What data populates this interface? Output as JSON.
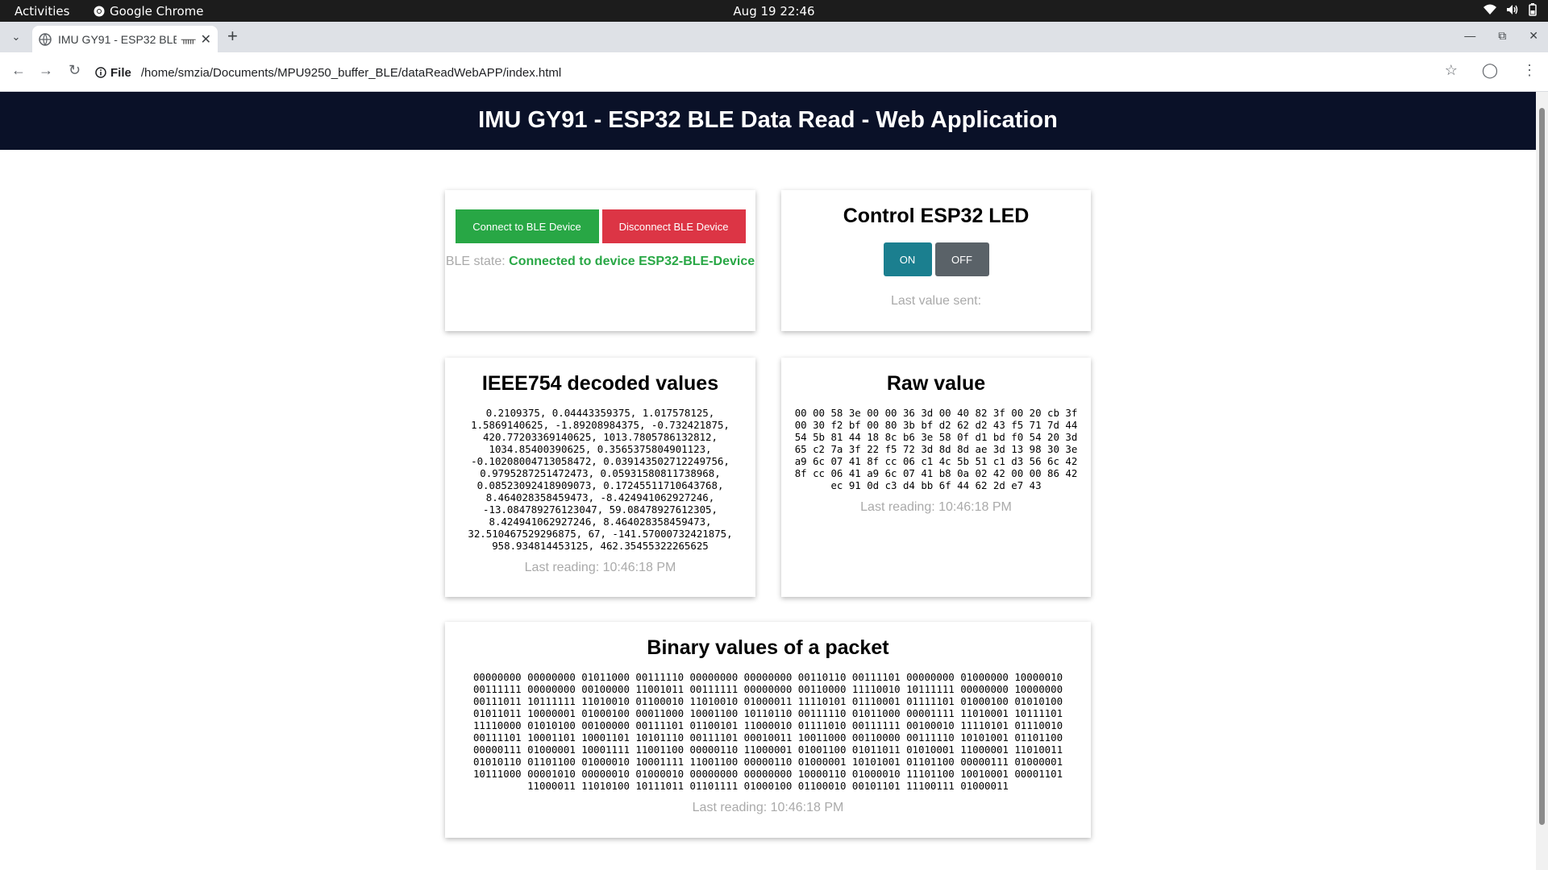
{
  "system": {
    "activities": "Activities",
    "app_name": "Google Chrome",
    "clock": "Aug 19  22:46"
  },
  "browser": {
    "tab_title": "IMU GY91 - ESP32 BLE Data Read - Web Application",
    "url_scheme": "File",
    "url": "/home/smzia/Documents/MPU9250_buffer_BLE/dataReadWebAPP/index.html"
  },
  "page": {
    "header": "IMU GY91 - ESP32 BLE Data Read - Web Application",
    "connection": {
      "connect_label": "Connect to BLE Device",
      "disconnect_label": "Disconnect BLE Device",
      "state_label": "BLE state:",
      "state_value": "Connected to device ESP32-BLE-Device",
      "state_color": "#28a745"
    },
    "led": {
      "title": "Control ESP32 LED",
      "on_label": "ON",
      "off_label": "OFF",
      "last_sent_label": "Last value sent:"
    },
    "decoded": {
      "title": "IEEE754 decoded values",
      "values": "0.2109375, 0.04443359375, 1.017578125,\n1.5869140625, -1.89208984375, -0.732421875,\n420.77203369140625, 1013.7805786132812,\n1034.85400390625, 0.3565375804901123,\n-0.10208004713058472, 0.039143502712249756,\n0.9795287251472473, 0.05931580811738968,\n0.08523092418909073, 0.17245511710643768,\n8.464028358459473, -8.424941062927246,\n-13.084789276123047, 59.08478927612305,\n8.424941062927246, 8.464028358459473,\n32.510467529296875, 67, -141.57000732421875,\n958.934814453125, 462.35455322265625",
      "last_reading": "Last reading: 10:46:18 PM"
    },
    "raw": {
      "title": "Raw value",
      "values": "00 00 58 3e 00 00 36 3d 00 40 82 3f 00 20 cb 3f\n00 30 f2 bf 00 80 3b bf d2 62 d2 43 f5 71 7d 44\n54 5b 81 44 18 8c b6 3e 58 0f d1 bd f0 54 20 3d\n65 c2 7a 3f 22 f5 72 3d 8d 8d ae 3d 13 98 30 3e\na9 6c 07 41 8f cc 06 c1 4c 5b 51 c1 d3 56 6c 42\n8f cc 06 41 a9 6c 07 41 b8 0a 02 42 00 00 86 42\nec 91 0d c3 d4 bb 6f 44 62 2d e7 43",
      "last_reading": "Last reading: 10:46:18 PM"
    },
    "binary": {
      "title": "Binary values of a packet",
      "values": "00000000 00000000 01011000 00111110 00000000 00000000 00110110 00111101 00000000 01000000 10000010\n00111111 00000000 00100000 11001011 00111111 00000000 00110000 11110010 10111111 00000000 10000000\n00111011 10111111 11010010 01100010 11010010 01000011 11110101 01110001 01111101 01000100 01010100\n01011011 10000001 01000100 00011000 10001100 10110110 00111110 01011000 00001111 11010001 10111101\n11110000 01010100 00100000 00111101 01100101 11000010 01111010 00111111 00100010 11110101 01110010\n00111101 10001101 10001101 10101110 00111101 00010011 10011000 00110000 00111110 10101001 01101100\n00000111 01000001 10001111 11001100 00000110 11000001 01001100 01011011 01010001 11000001 11010011\n01010110 01101100 01000010 10001111 11001100 00000110 01000001 10101001 01101100 00000111 01000001\n10111000 00001010 00000010 01000010 00000000 00000000 10000110 01000010 11101100 10010001 00001101\n11000011 11010100 10111011 01101111 01000100 01100010 00101101 11100111 01000011",
      "last_reading": "Last reading: 10:46:18 PM"
    }
  }
}
